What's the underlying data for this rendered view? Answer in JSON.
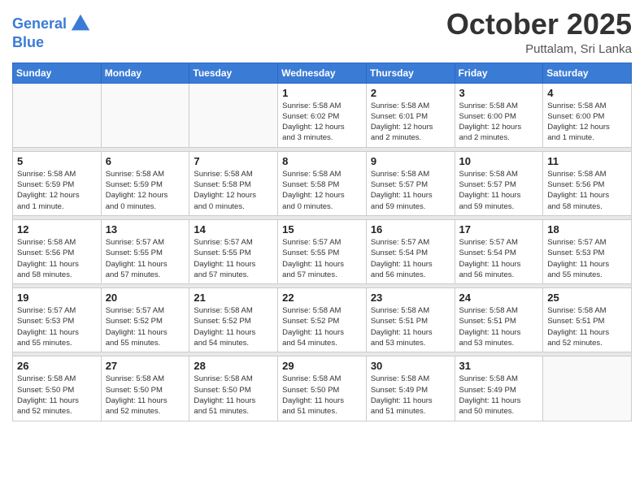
{
  "header": {
    "logo_text1": "General",
    "logo_text2": "Blue",
    "month": "October 2025",
    "location": "Puttalam, Sri Lanka"
  },
  "days_of_week": [
    "Sunday",
    "Monday",
    "Tuesday",
    "Wednesday",
    "Thursday",
    "Friday",
    "Saturday"
  ],
  "weeks": [
    [
      {
        "day": "",
        "info": ""
      },
      {
        "day": "",
        "info": ""
      },
      {
        "day": "",
        "info": ""
      },
      {
        "day": "1",
        "info": "Sunrise: 5:58 AM\nSunset: 6:02 PM\nDaylight: 12 hours\nand 3 minutes."
      },
      {
        "day": "2",
        "info": "Sunrise: 5:58 AM\nSunset: 6:01 PM\nDaylight: 12 hours\nand 2 minutes."
      },
      {
        "day": "3",
        "info": "Sunrise: 5:58 AM\nSunset: 6:00 PM\nDaylight: 12 hours\nand 2 minutes."
      },
      {
        "day": "4",
        "info": "Sunrise: 5:58 AM\nSunset: 6:00 PM\nDaylight: 12 hours\nand 1 minute."
      }
    ],
    [
      {
        "day": "5",
        "info": "Sunrise: 5:58 AM\nSunset: 5:59 PM\nDaylight: 12 hours\nand 1 minute."
      },
      {
        "day": "6",
        "info": "Sunrise: 5:58 AM\nSunset: 5:59 PM\nDaylight: 12 hours\nand 0 minutes."
      },
      {
        "day": "7",
        "info": "Sunrise: 5:58 AM\nSunset: 5:58 PM\nDaylight: 12 hours\nand 0 minutes."
      },
      {
        "day": "8",
        "info": "Sunrise: 5:58 AM\nSunset: 5:58 PM\nDaylight: 12 hours\nand 0 minutes."
      },
      {
        "day": "9",
        "info": "Sunrise: 5:58 AM\nSunset: 5:57 PM\nDaylight: 11 hours\nand 59 minutes."
      },
      {
        "day": "10",
        "info": "Sunrise: 5:58 AM\nSunset: 5:57 PM\nDaylight: 11 hours\nand 59 minutes."
      },
      {
        "day": "11",
        "info": "Sunrise: 5:58 AM\nSunset: 5:56 PM\nDaylight: 11 hours\nand 58 minutes."
      }
    ],
    [
      {
        "day": "12",
        "info": "Sunrise: 5:58 AM\nSunset: 5:56 PM\nDaylight: 11 hours\nand 58 minutes."
      },
      {
        "day": "13",
        "info": "Sunrise: 5:57 AM\nSunset: 5:55 PM\nDaylight: 11 hours\nand 57 minutes."
      },
      {
        "day": "14",
        "info": "Sunrise: 5:57 AM\nSunset: 5:55 PM\nDaylight: 11 hours\nand 57 minutes."
      },
      {
        "day": "15",
        "info": "Sunrise: 5:57 AM\nSunset: 5:55 PM\nDaylight: 11 hours\nand 57 minutes."
      },
      {
        "day": "16",
        "info": "Sunrise: 5:57 AM\nSunset: 5:54 PM\nDaylight: 11 hours\nand 56 minutes."
      },
      {
        "day": "17",
        "info": "Sunrise: 5:57 AM\nSunset: 5:54 PM\nDaylight: 11 hours\nand 56 minutes."
      },
      {
        "day": "18",
        "info": "Sunrise: 5:57 AM\nSunset: 5:53 PM\nDaylight: 11 hours\nand 55 minutes."
      }
    ],
    [
      {
        "day": "19",
        "info": "Sunrise: 5:57 AM\nSunset: 5:53 PM\nDaylight: 11 hours\nand 55 minutes."
      },
      {
        "day": "20",
        "info": "Sunrise: 5:57 AM\nSunset: 5:52 PM\nDaylight: 11 hours\nand 55 minutes."
      },
      {
        "day": "21",
        "info": "Sunrise: 5:58 AM\nSunset: 5:52 PM\nDaylight: 11 hours\nand 54 minutes."
      },
      {
        "day": "22",
        "info": "Sunrise: 5:58 AM\nSunset: 5:52 PM\nDaylight: 11 hours\nand 54 minutes."
      },
      {
        "day": "23",
        "info": "Sunrise: 5:58 AM\nSunset: 5:51 PM\nDaylight: 11 hours\nand 53 minutes."
      },
      {
        "day": "24",
        "info": "Sunrise: 5:58 AM\nSunset: 5:51 PM\nDaylight: 11 hours\nand 53 minutes."
      },
      {
        "day": "25",
        "info": "Sunrise: 5:58 AM\nSunset: 5:51 PM\nDaylight: 11 hours\nand 52 minutes."
      }
    ],
    [
      {
        "day": "26",
        "info": "Sunrise: 5:58 AM\nSunset: 5:50 PM\nDaylight: 11 hours\nand 52 minutes."
      },
      {
        "day": "27",
        "info": "Sunrise: 5:58 AM\nSunset: 5:50 PM\nDaylight: 11 hours\nand 52 minutes."
      },
      {
        "day": "28",
        "info": "Sunrise: 5:58 AM\nSunset: 5:50 PM\nDaylight: 11 hours\nand 51 minutes."
      },
      {
        "day": "29",
        "info": "Sunrise: 5:58 AM\nSunset: 5:50 PM\nDaylight: 11 hours\nand 51 minutes."
      },
      {
        "day": "30",
        "info": "Sunrise: 5:58 AM\nSunset: 5:49 PM\nDaylight: 11 hours\nand 51 minutes."
      },
      {
        "day": "31",
        "info": "Sunrise: 5:58 AM\nSunset: 5:49 PM\nDaylight: 11 hours\nand 50 minutes."
      },
      {
        "day": "",
        "info": ""
      }
    ]
  ]
}
